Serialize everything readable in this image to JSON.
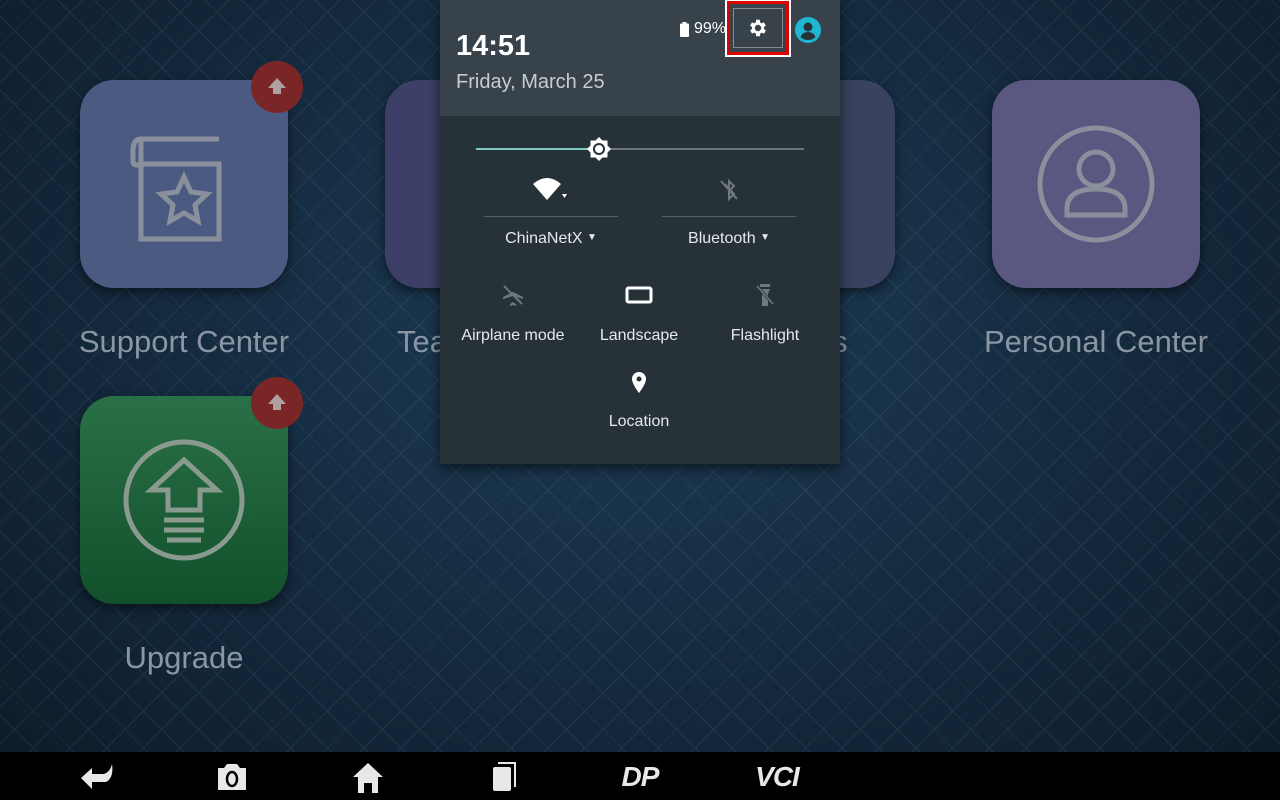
{
  "home": {
    "apps": [
      {
        "label": "Support Center",
        "color": "#4b5a80",
        "badge": true
      },
      {
        "label": "Tea",
        "color": "#3d3f68"
      },
      {
        "label": "s",
        "color": "#39425e"
      },
      {
        "label": "Personal Center",
        "color": "#5a5780"
      },
      {
        "label": "Upgrade",
        "color": "#1c6a3a",
        "badge": true
      }
    ]
  },
  "quick_settings": {
    "time": "14:51",
    "date": "Friday, March 25",
    "battery": "99%",
    "settings_icon": "gear-icon",
    "highlight_color": "#e00000",
    "user_icon_color": "#1eb8d4",
    "brightness": 0.375,
    "wifi": {
      "label": "ChinaNetX",
      "on": true
    },
    "bluetooth": {
      "label": "Bluetooth",
      "on": false
    },
    "tiles": [
      {
        "label": "Airplane mode",
        "on": false
      },
      {
        "label": "Landscape",
        "on": true
      },
      {
        "label": "Flashlight",
        "on": false
      },
      {
        "label": "Location",
        "on": true
      }
    ]
  },
  "navbar": {
    "items": [
      "back-icon",
      "screenshot-icon",
      "home-icon",
      "recents-icon",
      "DP",
      "VCI"
    ]
  }
}
